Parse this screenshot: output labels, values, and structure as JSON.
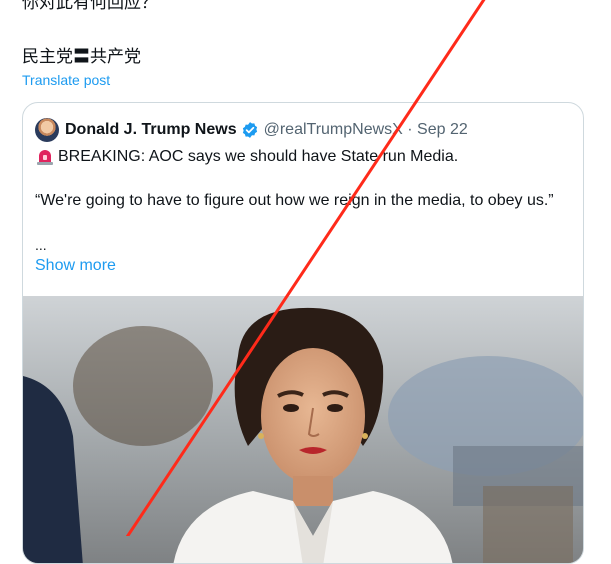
{
  "post": {
    "question_text": "你对此有何回应？",
    "party_text": "民主党〓共产党",
    "translate_label": "Translate post"
  },
  "quoted_post": {
    "author_name": "Donald J. Trump News",
    "handle_date": "@realTrumpNewsX · Sep 22",
    "breaking_text": "BREAKING: AOC says we should have State run Media.",
    "quote_text": "“We're going to have to figure out how we reign in the media, to obey us.”",
    "ellipsis": "...",
    "show_more_label": "Show more"
  },
  "colors": {
    "link": "#1d9bf0",
    "verified": "#1d9bf0",
    "annotation_line": "#ff2a1a"
  },
  "icons": {
    "siren": "rotating-light-icon",
    "verified": "verified-badge-icon"
  }
}
